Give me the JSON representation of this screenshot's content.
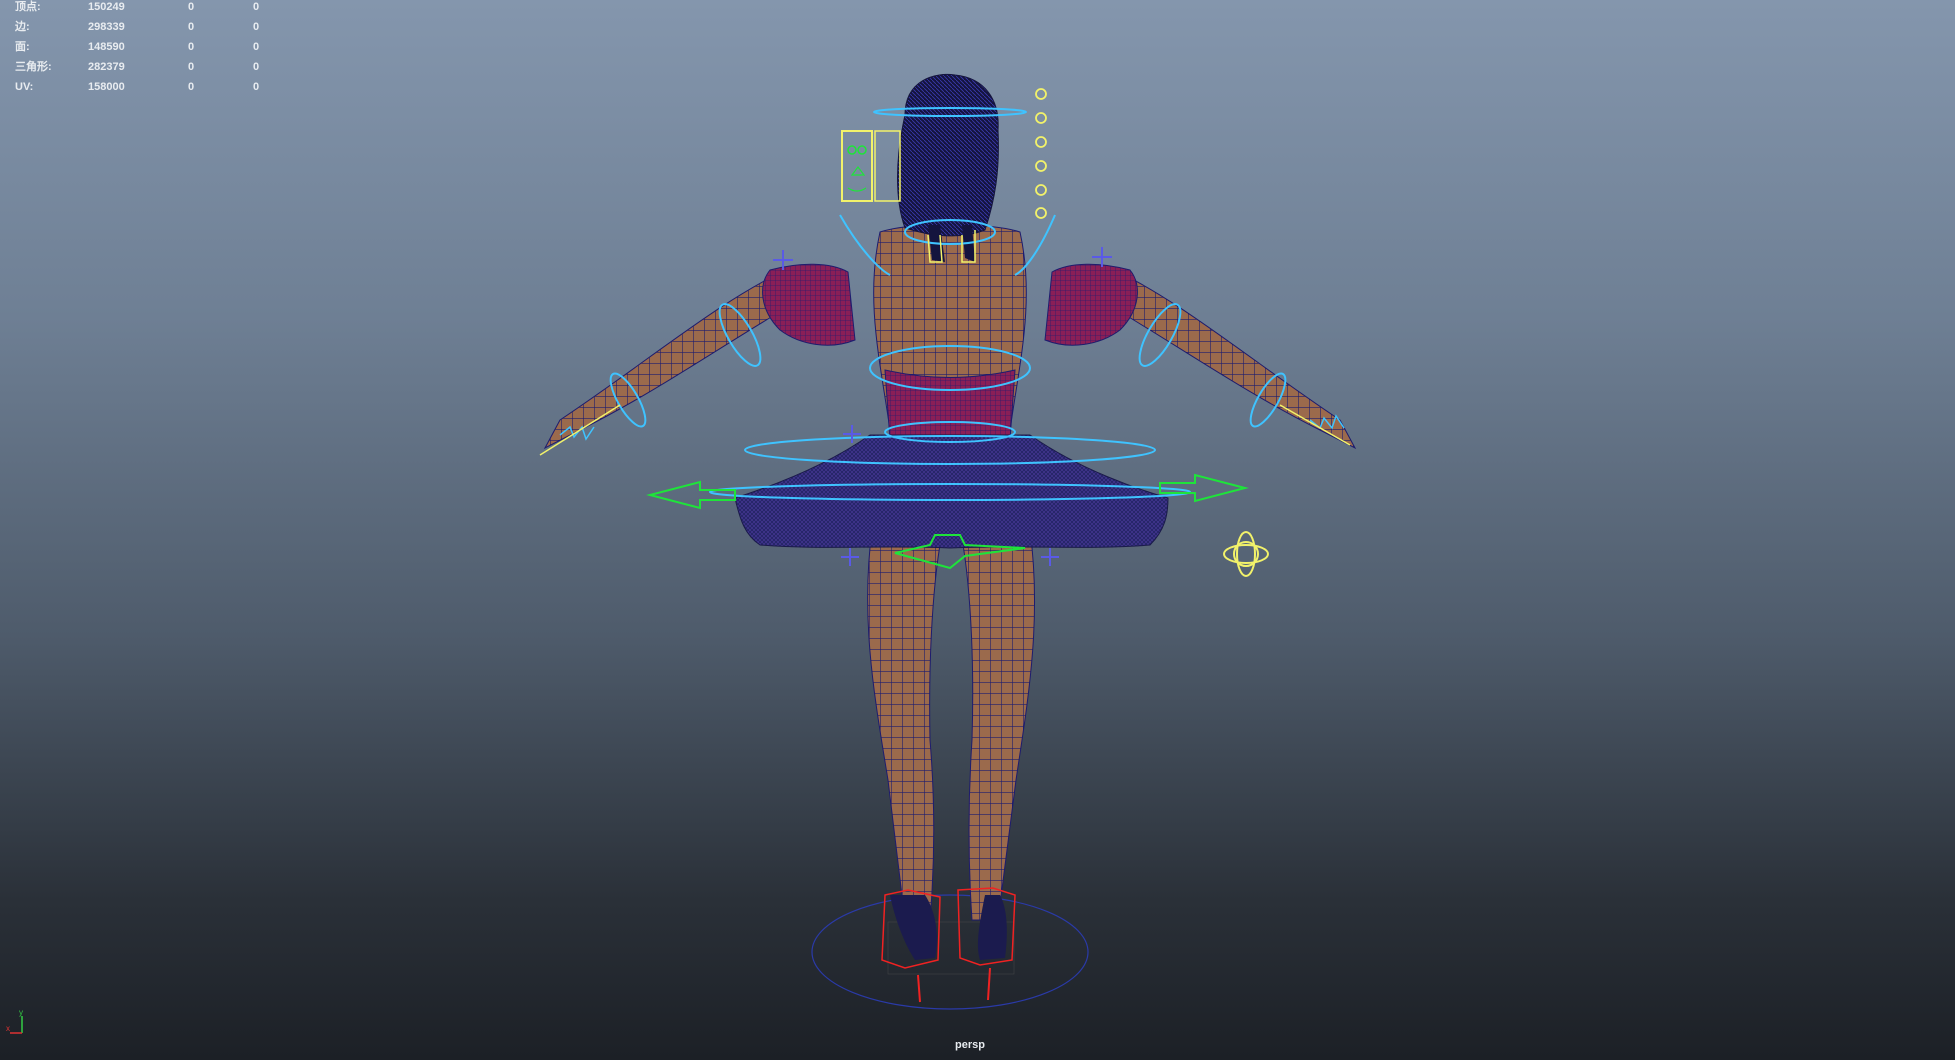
{
  "hud": {
    "rows": [
      {
        "label": "顶点:",
        "v1": "150249",
        "v2": "0",
        "v3": "0"
      },
      {
        "label": "边:",
        "v1": "298339",
        "v2": "0",
        "v3": "0"
      },
      {
        "label": "面:",
        "v1": "148590",
        "v2": "0",
        "v3": "0"
      },
      {
        "label": "三角形:",
        "v1": "282379",
        "v2": "0",
        "v3": "0"
      },
      {
        "label": "UV:",
        "v1": "158000",
        "v2": "0",
        "v3": "0"
      }
    ]
  },
  "viewport": {
    "camera": "persp",
    "axis": {
      "x": "x",
      "y": "y"
    }
  },
  "colors": {
    "background_top": "#8496ad",
    "background_bottom": "#1c2026",
    "skin": "#9b6a4c",
    "wire": "#1e1c6e",
    "cloth": "#8a1f57",
    "skirt": "#242466",
    "ctrl_cyan": "#3fc3ff",
    "ctrl_green": "#1ee43a",
    "ctrl_yellow": "#f2f26a",
    "ctrl_red": "#f02222",
    "ctrl_blue": "#5a5ae6"
  }
}
